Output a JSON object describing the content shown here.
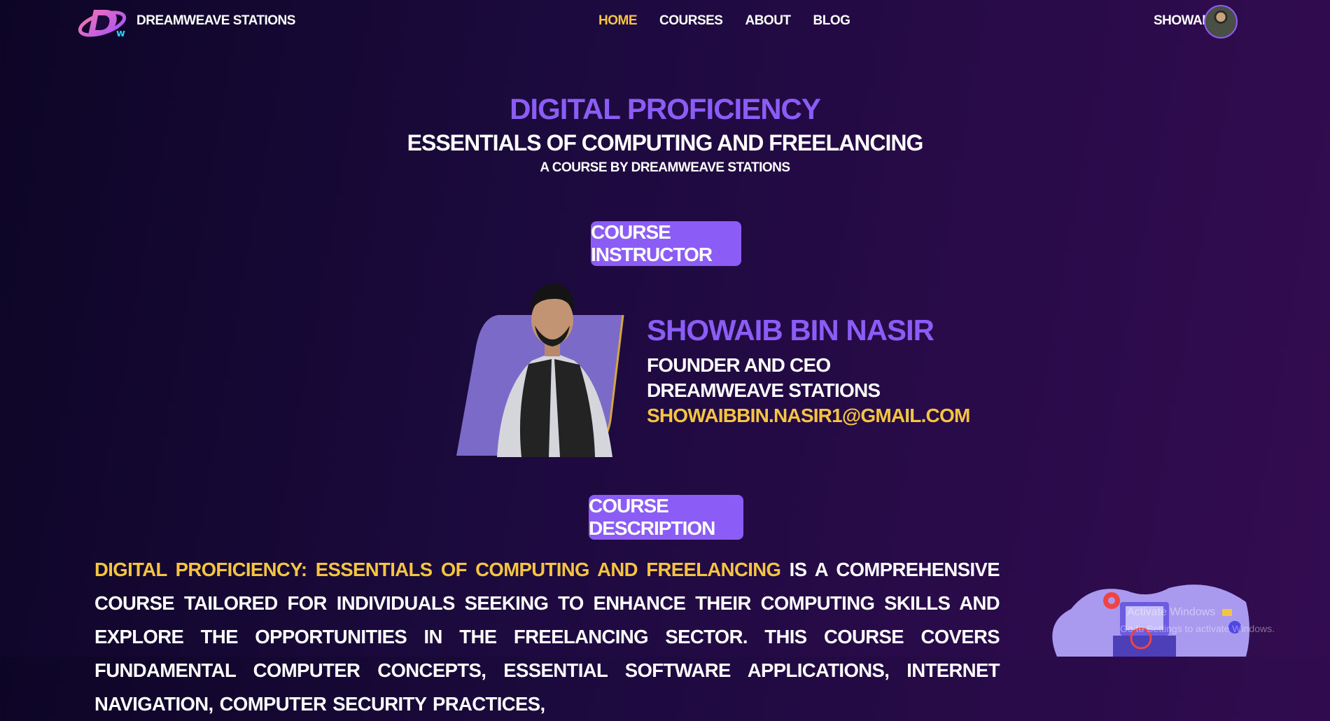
{
  "nav": {
    "brand": "DREAMWEAVE STATIONS",
    "links": [
      {
        "label": "HOME",
        "active": true
      },
      {
        "label": "COURSES",
        "active": false
      },
      {
        "label": "ABOUT",
        "active": false
      },
      {
        "label": "BLOG",
        "active": false
      }
    ],
    "user_name": "SHOWAIB"
  },
  "hero": {
    "title": "DIGITAL PROFICIENCY",
    "subtitle": "ESSENTIALS OF COMPUTING AND FREELANCING",
    "tagline": "A COURSE BY DREAMWEAVE STATIONS"
  },
  "instructor": {
    "section_label": "COURSE INSTRUCTOR",
    "name": "SHOWAIB BIN NASIR",
    "role": "FOUNDER AND CEO",
    "organization": "DREAMWEAVE STATIONS",
    "email": "SHOWAIBBIN.NASIR1@GMAIL.COM"
  },
  "description": {
    "section_label": "COURSE DESCRIPTION",
    "highlight": "DIGITAL PROFICIENCY: ESSENTIALS OF COMPUTING AND FREELANCING",
    "body": " IS A COMPREHENSIVE COURSE TAILORED FOR INDIVIDUALS SEEKING TO ENHANCE THEIR COMPUTING SKILLS AND EXPLORE THE OPPORTUNITIES IN THE FREELANCING SECTOR. THIS COURSE COVERS FUNDAMENTAL COMPUTER CONCEPTS, ESSENTIAL SOFTWARE APPLICATIONS, INTERNET NAVIGATION, COMPUTER SECURITY PRACTICES,"
  },
  "overlay": {
    "watermark_line1": "Activate Windows",
    "watermark_line2": "Go to Settings to activate Windows."
  },
  "colors": {
    "accent": "#8b5cf6",
    "highlight": "#f5c542",
    "background": "#1c0a3e"
  }
}
